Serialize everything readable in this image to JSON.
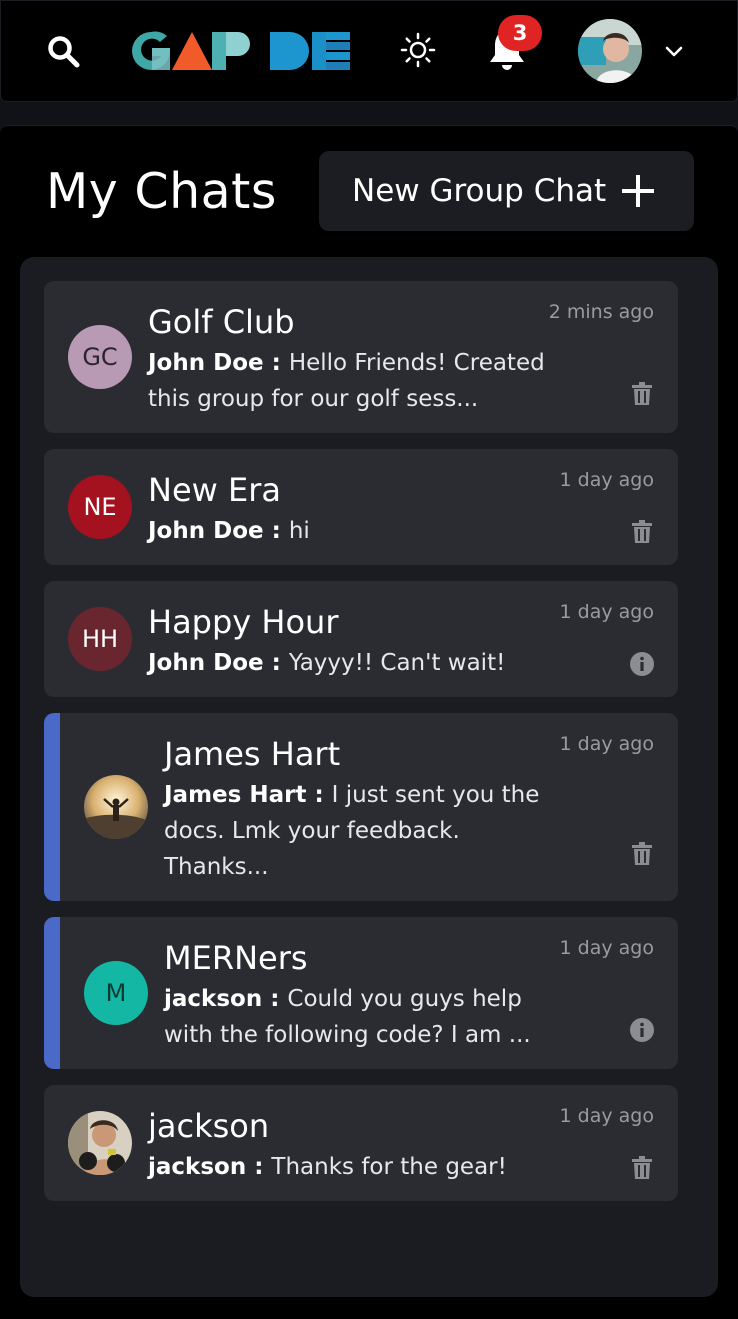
{
  "header": {
    "logo_text": "GAP DE",
    "notification_count": "3",
    "icons": [
      "search-icon",
      "sun-icon",
      "bell-icon",
      "chevron-down-icon"
    ]
  },
  "page": {
    "title": "My Chats",
    "new_group_label": "New Group Chat"
  },
  "colors": {
    "unread_accent": "#4a69c9",
    "badge": "#e02424",
    "card_bg": "#2b2c32"
  },
  "chats": [
    {
      "name": "Golf Club",
      "initials": "GC",
      "avatar_color": "#b99ab5",
      "initials_color": "#2d2430",
      "sender": "John Doe",
      "message": "Hello Friends! Created this group for our golf sess...",
      "time": "2 mins ago",
      "action": "trash-icon"
    },
    {
      "name": "New Era",
      "initials": "NE",
      "avatar_color": "#a3121e",
      "initials_color": "#ffffff",
      "sender": "John Doe",
      "message": "hi",
      "time": "1 day ago",
      "action": "trash-icon"
    },
    {
      "name": "Happy Hour",
      "initials": "HH",
      "avatar_color": "#6a262f",
      "initials_color": "#ffffff",
      "sender": "John Doe",
      "message": "Yayyy!! Can't wait!",
      "time": "1 day ago",
      "action": "info-icon"
    },
    {
      "name": "James Hart",
      "initials": "",
      "sender": "James Hart",
      "message": "I just sent you the docs. Lmk your feedback. Thanks...",
      "time": "1 day ago",
      "action": "trash-icon",
      "unread": true
    },
    {
      "name": "MERNers",
      "initials": "M",
      "avatar_color": "#13b7a3",
      "initials_color": "#123832",
      "sender": "jackson",
      "message": "Could you guys help with the following code? I am ...",
      "time": "1 day ago",
      "action": "info-icon",
      "unread": true
    },
    {
      "name": "jackson",
      "initials": "",
      "sender": "jackson",
      "message": "Thanks for the gear!",
      "time": "1 day ago",
      "action": "trash-icon"
    }
  ]
}
